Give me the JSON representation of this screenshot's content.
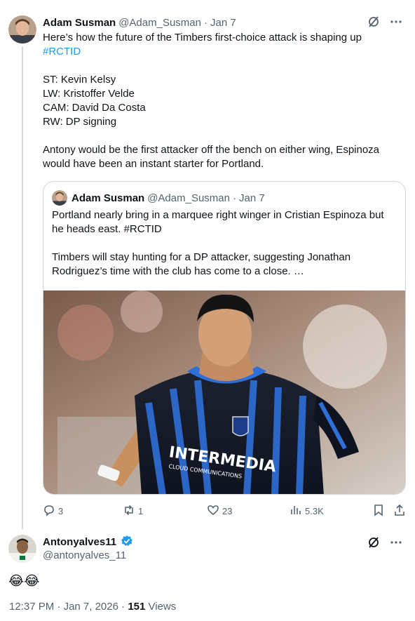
{
  "main_tweet": {
    "author_name": "Adam Susman",
    "author_handle": "@Adam_Susman",
    "separator": "·",
    "date": "Jan 7",
    "lines": [
      "Here’s how the future of the Timbers first-choice attack is shaping up",
      "#RCTID",
      "ST: Kevin Kelsy",
      "LW: Kristoffer Velde",
      "CAM: David Da Costa",
      "RW: DP signing",
      "Antony would be the first attacker off the bench on either wing, Espinoza would have been an instant starter for Portland."
    ]
  },
  "quoted_tweet": {
    "author_name": "Adam Susman",
    "author_handle": "@Adam_Susman",
    "separator": "·",
    "date": "Jan 7",
    "text_1": "Portland nearly bring in a marquee right winger in Cristian Espinoza but he heads east. ",
    "hashtag": "#RCTID",
    "text_2": "Timbers will stay hunting for a DP attacker, suggesting Jonathan Rodriguez’s time with the club has come to a close.  …",
    "image_jersey_text": "INTERMEDIA",
    "image_jersey_subtext": "CLOUD COMMUNICATIONS"
  },
  "actions": {
    "replies": "3",
    "retweets": "1",
    "likes": "23",
    "views": "5.3K"
  },
  "reply": {
    "author_name": "Antonyalves11",
    "author_handle": "@antonyalves_11",
    "text": "😂😂",
    "time": "12:37 PM",
    "separator": "·",
    "date": "Jan 7, 2026",
    "views_count": "151",
    "views_label": "Views"
  },
  "colors": {
    "accent": "#1d9bf0",
    "secondary_text": "#536471",
    "border": "#cfd9de",
    "jersey_blue": "#2f6fd8"
  },
  "icons": [
    "grok-icon",
    "more-icon",
    "reply-icon",
    "retweet-icon",
    "like-icon",
    "views-icon",
    "bookmark-icon",
    "share-icon",
    "verified-badge-icon"
  ]
}
